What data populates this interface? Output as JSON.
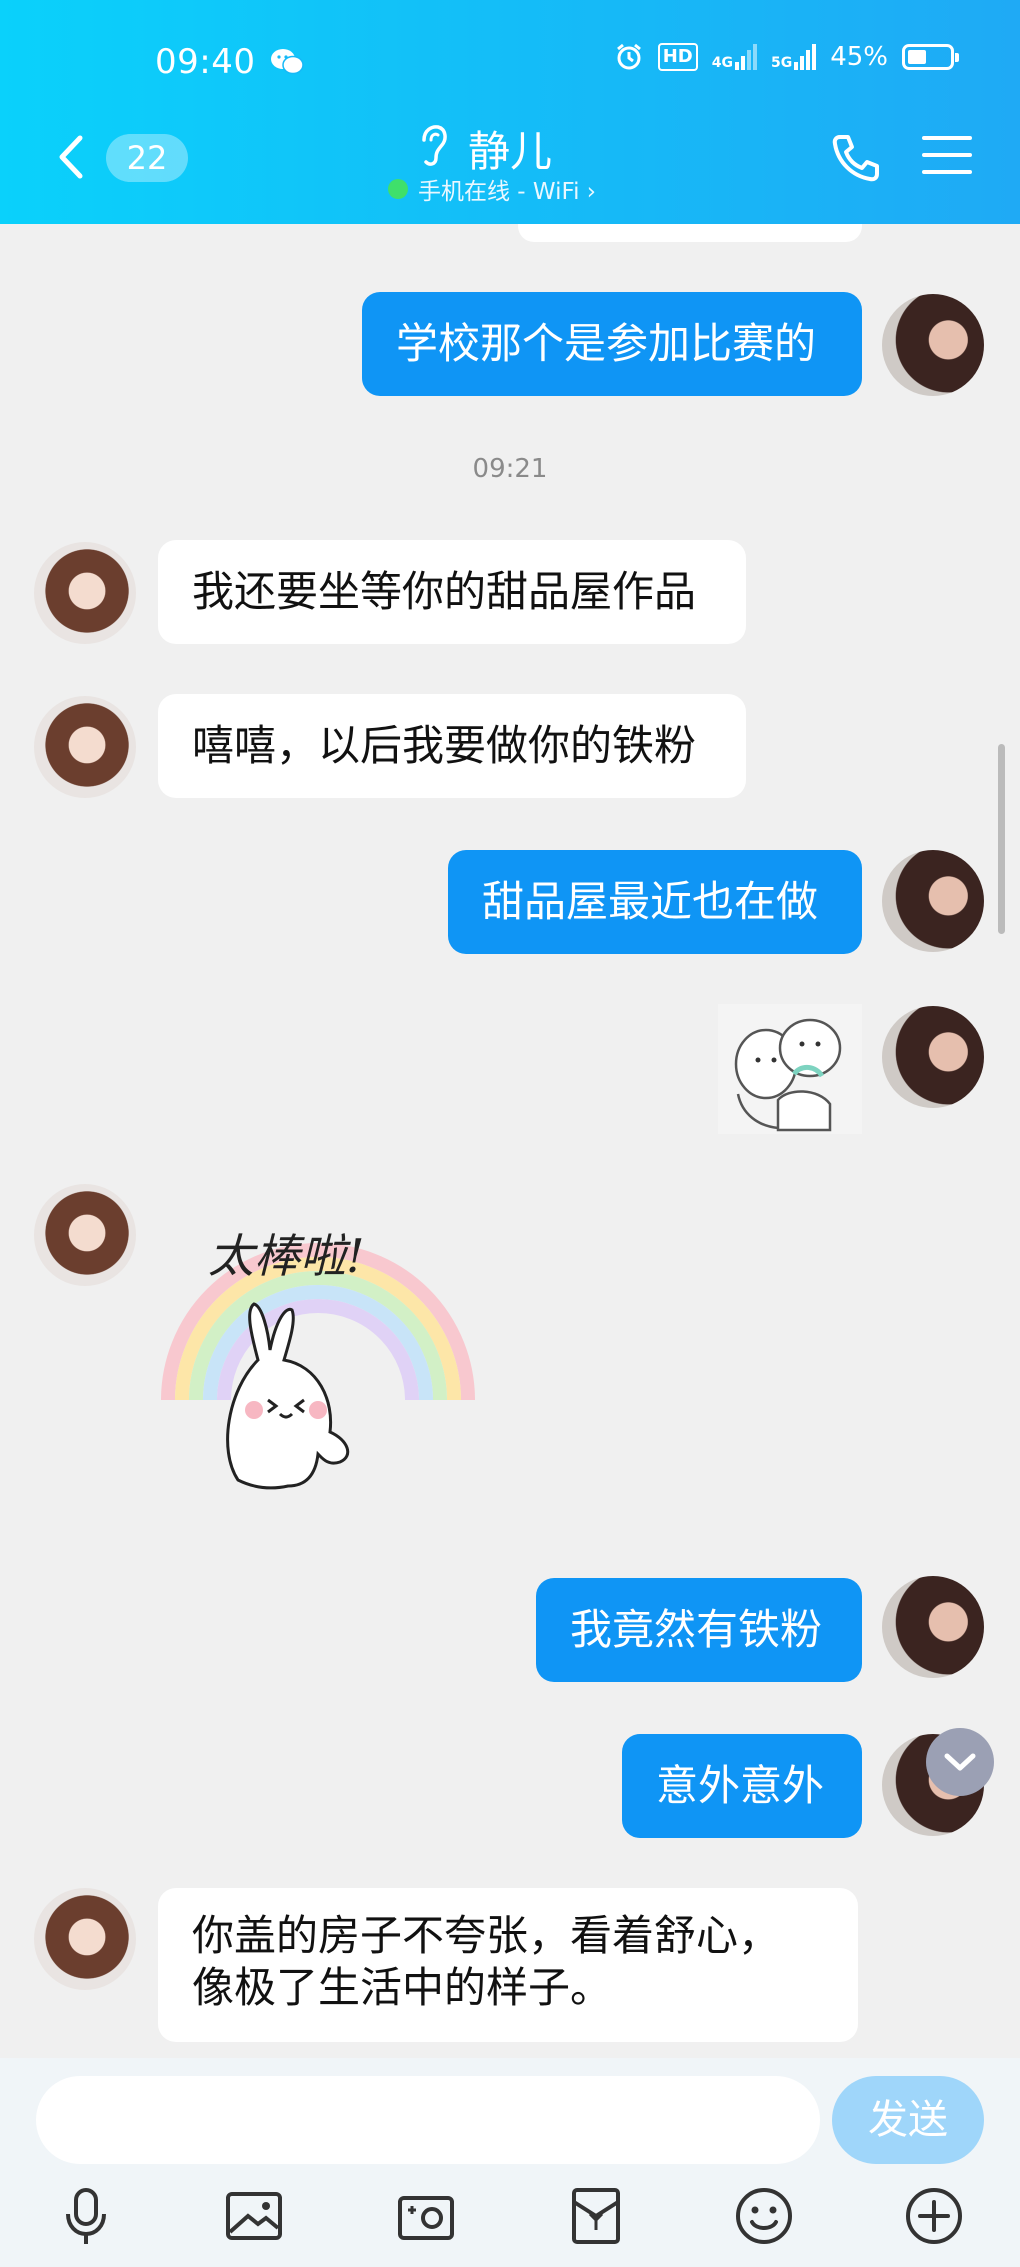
{
  "status_bar": {
    "time": "09:40",
    "hd_label": "HD",
    "network_4g": "4G",
    "network_5g": "5G",
    "battery": "45%"
  },
  "header": {
    "unread_count": "22",
    "contact_name": "静儿",
    "online_status": "手机在线 - WiFi ›"
  },
  "messages": [
    {
      "side": "out",
      "type": "text",
      "text": "学校那个是参加比赛的"
    },
    {
      "type": "time",
      "text": "09:21"
    },
    {
      "side": "in",
      "type": "text",
      "text": "我还要坐等你的甜品屋作品"
    },
    {
      "side": "in",
      "type": "text",
      "text": "嘻嘻，以后我要做你的铁粉"
    },
    {
      "side": "out",
      "type": "text",
      "text": "甜品屋最近也在做"
    },
    {
      "side": "out",
      "type": "sticker",
      "sticker": "hugging-cartoon"
    },
    {
      "side": "in",
      "type": "sticker",
      "sticker": "rainbow-bunny",
      "caption": "太棒啦!"
    },
    {
      "side": "out",
      "type": "text",
      "text": "我竟然有铁粉"
    },
    {
      "side": "out",
      "type": "text",
      "text": "意外意外"
    },
    {
      "side": "in",
      "type": "text",
      "lines": [
        "你盖的房子不夸张，看着舒心，",
        "像极了生活中的样子。"
      ]
    }
  ],
  "input": {
    "value": "",
    "placeholder": "",
    "send_label": "发送"
  },
  "toolbar_icons": [
    "microphone-icon",
    "image-icon",
    "camera-icon",
    "red-packet-icon",
    "emoji-icon",
    "plus-icon"
  ],
  "colors": {
    "header": "#16b9f7",
    "outgoing_bubble": "#0f95f5",
    "incoming_bubble": "#ffffff",
    "background": "#f0f0f0",
    "online": "#3fe06b"
  }
}
